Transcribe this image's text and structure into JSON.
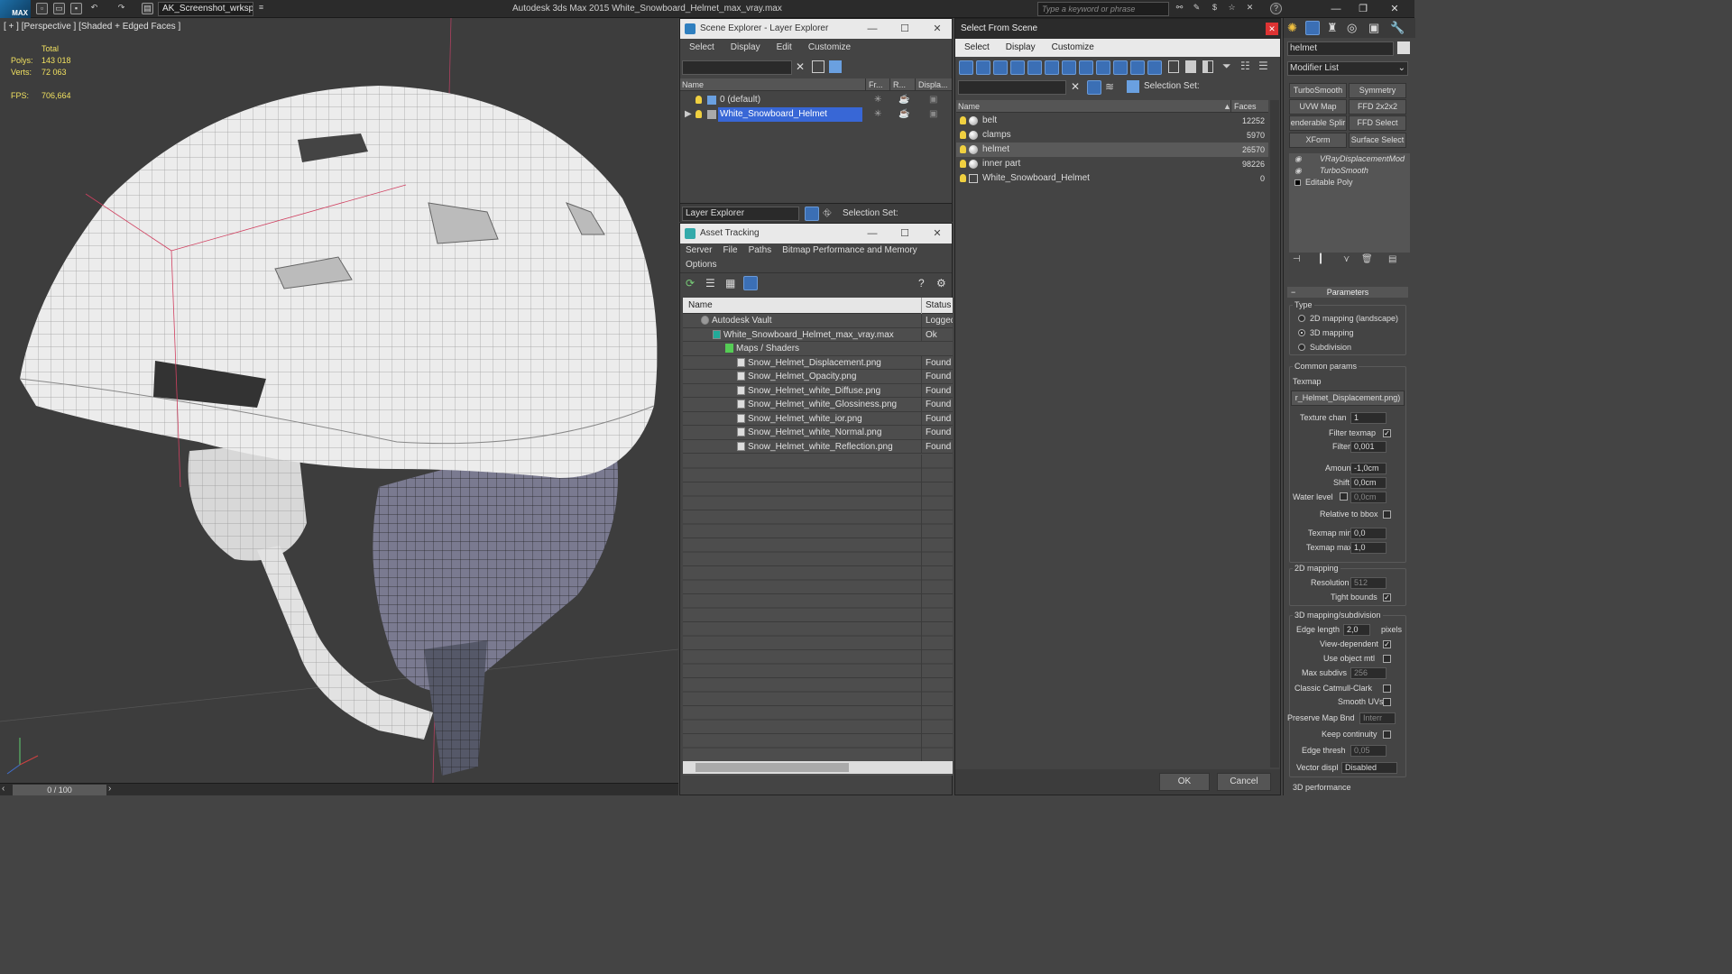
{
  "titlebar": {
    "logo": "MAX",
    "workspace": "AK_Screenshot_wrksp",
    "app_title": "Autodesk 3ds Max  2015     White_Snowboard_Helmet_max_vray.max",
    "search_placeholder": "Type a keyword or phrase"
  },
  "viewport": {
    "label": "[ + ] [Perspective ] [Shaded + Edged Faces ]",
    "total_label": "Total",
    "polys_label": "Polys:",
    "polys_value": "143 018",
    "verts_label": "Verts:",
    "verts_value": "72 063",
    "fps_label": "FPS:",
    "fps_value": "706,664",
    "timeline": "0 / 100"
  },
  "scene_explorer": {
    "title": "Scene Explorer - Layer Explorer",
    "menu": [
      "Select",
      "Display",
      "Edit",
      "Customize"
    ],
    "columns": [
      "Name",
      "Fr...",
      "R...",
      "Displa..."
    ],
    "rows": [
      "0 (default)",
      "White_Snowboard_Helmet"
    ],
    "footer_dropdown": "Layer Explorer",
    "selection_set_label": "Selection Set:"
  },
  "asset_tracking": {
    "title": "Asset Tracking",
    "menu": [
      "Server",
      "File",
      "Paths",
      "Bitmap Performance and Memory"
    ],
    "menu2": "Options",
    "columns": [
      "Name",
      "Status"
    ],
    "rows": [
      {
        "name": "Autodesk Vault",
        "status": "Logged"
      },
      {
        "name": "White_Snowboard_Helmet_max_vray.max",
        "status": "Ok"
      },
      {
        "name": "Maps / Shaders",
        "status": ""
      },
      {
        "name": "Snow_Helmet_Displacement.png",
        "status": "Found"
      },
      {
        "name": "Snow_Helmet_Opacity.png",
        "status": "Found"
      },
      {
        "name": "Snow_Helmet_white_Diffuse.png",
        "status": "Found"
      },
      {
        "name": "Snow_Helmet_white_Glossiness.png",
        "status": "Found"
      },
      {
        "name": "Snow_Helmet_white_ior.png",
        "status": "Found"
      },
      {
        "name": "Snow_Helmet_white_Normal.png",
        "status": "Found"
      },
      {
        "name": "Snow_Helmet_white_Reflection.png",
        "status": "Found"
      }
    ]
  },
  "select_from_scene": {
    "title": "Select From Scene",
    "menu": [
      "Select",
      "Display",
      "Customize"
    ],
    "selection_set_label": "Selection Set:",
    "columns": [
      "Name",
      "Faces"
    ],
    "rows": [
      {
        "name": "belt",
        "faces": "12252"
      },
      {
        "name": "clamps",
        "faces": "5970"
      },
      {
        "name": "helmet",
        "faces": "26570"
      },
      {
        "name": "inner part",
        "faces": "98226"
      },
      {
        "name": "White_Snowboard_Helmet",
        "faces": "0"
      }
    ],
    "ok": "OK",
    "cancel": "Cancel"
  },
  "command_panel": {
    "object_name": "helmet",
    "modifier_list": "Modifier List",
    "buttons": [
      "TurboSmooth",
      "Symmetry",
      "UVW Map",
      "FFD 2x2x2",
      "enderable Splir",
      "FFD Select",
      "XForm",
      "Surface Select"
    ],
    "stack": [
      "VRayDisplacementMod",
      "TurboSmooth",
      "Editable Poly"
    ],
    "params_title": "Parameters",
    "type_label": "Type",
    "type_options": [
      "2D mapping (landscape)",
      "3D mapping",
      "Subdivision"
    ],
    "common_params": "Common params",
    "texmap_label": "Texmap",
    "texmap_value": "r_Helmet_Displacement.png)",
    "texture_chan": "Texture chan",
    "texture_chan_val": "1",
    "filter_texmap": "Filter texmap",
    "filter_blur": "Filter blur",
    "filter_blur_val": "0,001",
    "amount": "Amount",
    "amount_val": "-1,0cm",
    "shift": "Shift",
    "shift_val": "0,0cm",
    "water_level": "Water level",
    "water_level_val": "0,0cm",
    "relative_bbox": "Relative to bbox",
    "texmap_min": "Texmap min",
    "texmap_min_val": "0,0",
    "texmap_max": "Texmap max",
    "texmap_max_val": "1,0",
    "mapping_2d": "2D mapping",
    "resolution": "Resolution",
    "resolution_val": "512",
    "tight_bounds": "Tight bounds",
    "mapping_3d": "3D mapping/subdivision",
    "edge_length": "Edge length",
    "edge_length_val": "2,0",
    "pixels": "pixels",
    "view_dependent": "View-dependent",
    "use_object_mtl": "Use object mtl",
    "max_subdivs": "Max subdivs",
    "max_subdivs_val": "256",
    "classic_cc": "Classic Catmull-Clark",
    "smooth_uvs": "Smooth UVs",
    "preserve_map": "Preserve Map Bnd",
    "preserve_map_val": "Interr",
    "keep_continuity": "Keep continuity",
    "edge_thresh": "Edge thresh",
    "edge_thresh_val": "0,05",
    "vector_displ": "Vector displ",
    "vector_displ_val": "Disabled",
    "perf_3d": "3D performance"
  }
}
